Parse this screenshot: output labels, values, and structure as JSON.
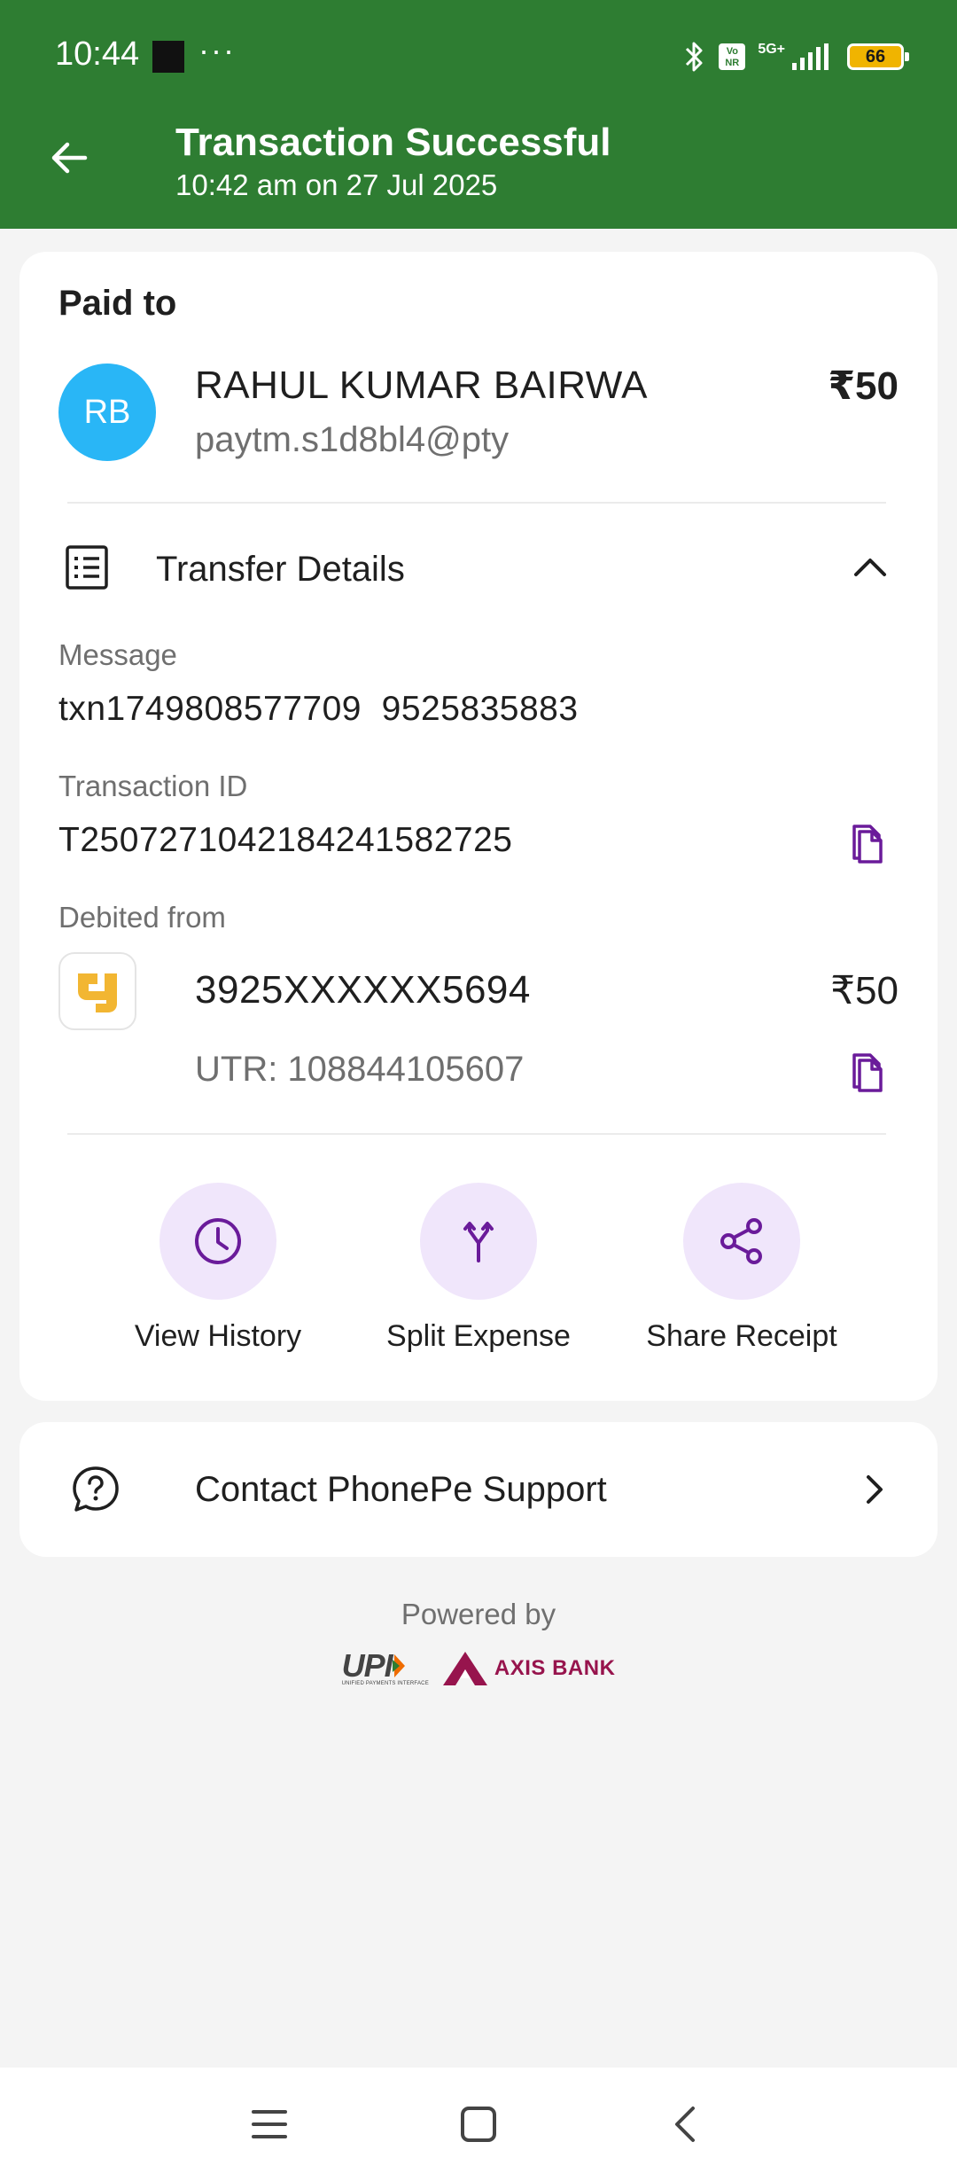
{
  "status_bar": {
    "time": "10:44",
    "dots": "···",
    "network": "5G+",
    "volte": "Vo NR",
    "battery": "66"
  },
  "header": {
    "title": "Transaction Successful",
    "subtitle": "10:42 am on 27 Jul 2025",
    "background_color": "#2e7d32"
  },
  "paid_to": {
    "heading": "Paid to",
    "avatar_initials": "RB",
    "name": "RAHUL KUMAR BAIRWA",
    "vpa": "paytm.s1d8bl4@pty",
    "amount": "₹50"
  },
  "transfer_details": {
    "label": "Transfer Details",
    "icon": "receipt-list-icon",
    "message_label": "Message",
    "message_value": "txn1749808577709  9525835883",
    "txn_id_label": "Transaction ID",
    "txn_id_value": "T2507271042184241582725",
    "debited_label": "Debited from",
    "account_number": "3925XXXXXX5694",
    "account_amount": "₹50",
    "utr": "UTR: 108844105607"
  },
  "actions": [
    {
      "label": "View History",
      "icon": "clock-icon"
    },
    {
      "label": "Split Expense",
      "icon": "split-arrows-icon"
    },
    {
      "label": "Share Receipt",
      "icon": "share-icon"
    }
  ],
  "support": {
    "label": "Contact PhonePe Support",
    "icon": "help-circle-icon"
  },
  "footer": {
    "powered_by": "Powered by",
    "upi": "UPI",
    "upi_sub": "UNIFIED PAYMENTS INTERFACE",
    "bank": "AXIS BANK"
  },
  "colors": {
    "accent_purple": "#6a1b9a",
    "action_bg": "#f0e6fb",
    "avatar": "#29b6f6"
  }
}
